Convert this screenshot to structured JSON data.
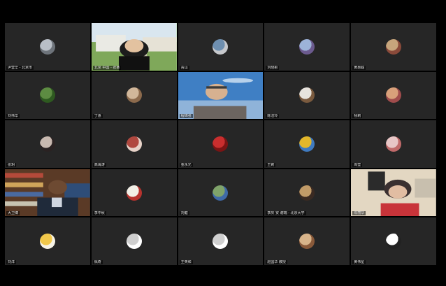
{
  "meeting": {
    "participants": [
      {
        "name": "尹营华 - 北京市",
        "kind": "avatar",
        "colors": [
          "#b9bfc7",
          "#6d737a"
        ]
      },
      {
        "name": "北京 中国 - 张某",
        "kind": "video",
        "scene": "outdoor-building"
      },
      {
        "name": "青山",
        "kind": "avatar",
        "colors": [
          "#6e8fb0",
          "#c6c8cc"
        ]
      },
      {
        "name": "刘晓彬",
        "kind": "avatar",
        "colors": [
          "#9db3d8",
          "#6b5a8e"
        ]
      },
      {
        "name": "黄惠聪",
        "kind": "avatar",
        "colors": [
          "#c7a57c",
          "#8a4a3a"
        ]
      },
      {
        "name": "刘伟华",
        "kind": "avatar",
        "colors": [
          "#5d8c42",
          "#2e5a20"
        ]
      },
      {
        "name": "丁惠",
        "kind": "avatar",
        "colors": [
          "#d1b79a",
          "#8c6a4c"
        ]
      },
      {
        "name": "程锦强",
        "kind": "video",
        "scene": "sky-older-man"
      },
      {
        "name": "陈洁玲",
        "kind": "avatar",
        "colors": [
          "#e7e3dc",
          "#7a5a3e"
        ]
      },
      {
        "name": "杨莉",
        "kind": "avatar",
        "colors": [
          "#d8a07a",
          "#a04c4c"
        ]
      },
      {
        "name": "张玥",
        "kind": "avatar",
        "colors": [
          "#c8b9b0",
          "#2a2222"
        ]
      },
      {
        "name": "高海涛",
        "kind": "avatar",
        "colors": [
          "#b0483f",
          "#e7d2c8"
        ]
      },
      {
        "name": "金永光",
        "kind": "avatar",
        "colors": [
          "#c92e2e",
          "#7a1414"
        ]
      },
      {
        "name": "王莉",
        "kind": "avatar",
        "colors": [
          "#e3b72a",
          "#3f7ac0"
        ]
      },
      {
        "name": "周莹",
        "kind": "avatar",
        "colors": [
          "#e8c6c6",
          "#c06a6a"
        ]
      },
      {
        "name": "大卫博",
        "kind": "video",
        "scene": "bookshelf-man"
      },
      {
        "name": "李中秋",
        "kind": "avatar",
        "colors": [
          "#f2efe6",
          "#b7332e"
        ]
      },
      {
        "name": "刘健",
        "kind": "avatar",
        "colors": [
          "#7fa36a",
          "#3f6aa8"
        ]
      },
      {
        "name": "李庆 安 谢瑞 - 北京大学",
        "kind": "avatar",
        "colors": [
          "#c19b68",
          "#3a2a22"
        ]
      },
      {
        "name": "陈丽华",
        "kind": "video",
        "scene": "room-woman"
      },
      {
        "name": "刘洋",
        "kind": "avatar",
        "colors": [
          "#f1c84b",
          "#f6f2e6"
        ]
      },
      {
        "name": "佩奇",
        "kind": "avatar",
        "colors": [
          "#cfcfcf",
          "#ffffff"
        ]
      },
      {
        "name": "王英和",
        "kind": "avatar",
        "colors": [
          "#cfcfcf",
          "#ffffff"
        ]
      },
      {
        "name": "赵国华 教授",
        "kind": "avatar",
        "colors": [
          "#d8b48a",
          "#8a5a3a"
        ]
      },
      {
        "name": "黄伟星",
        "kind": "avatar",
        "colors": [
          "#ffffff",
          "#222222"
        ]
      }
    ]
  }
}
